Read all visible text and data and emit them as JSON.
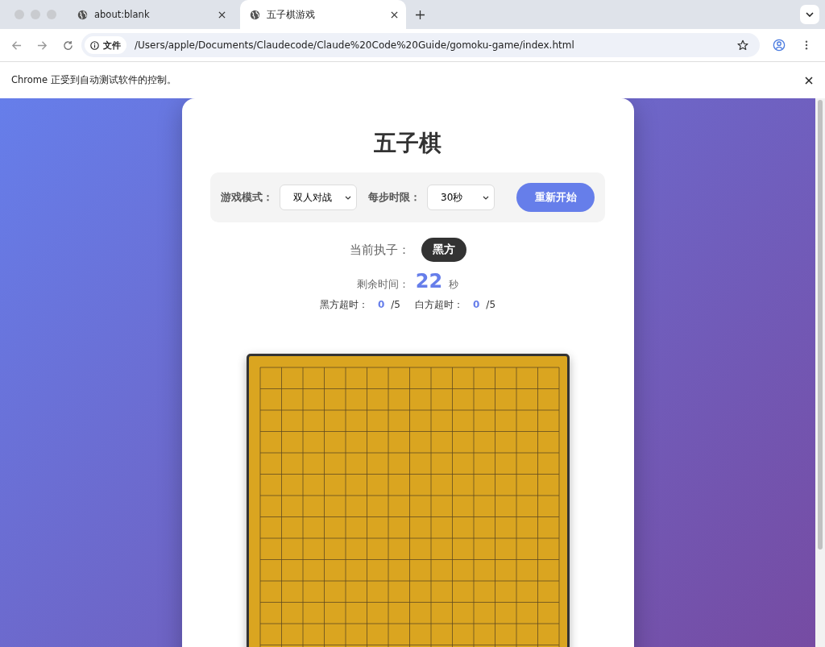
{
  "tabs": [
    {
      "title": "about:blank",
      "selected": false
    },
    {
      "title": "五子棋游戏",
      "selected": true
    }
  ],
  "address_bar": {
    "security_label": "文件",
    "url": "/Users/apple/Documents/Claudecode/Claude%20Code%20Guide/gomoku-game/index.html"
  },
  "infobar": {
    "message": "Chrome 正受到自动测试软件的控制。"
  },
  "game": {
    "title": "五子棋",
    "controls": [
      {
        "label": "游戏模式：",
        "value": "双人对战"
      },
      {
        "label": "每步时限：",
        "value": "30秒"
      }
    ],
    "restart_button": "重新开始",
    "current_player_label": "当前执子：",
    "current_player": "黑方",
    "time_label": "剩余时间：",
    "time_value": "22",
    "time_unit": "秒",
    "timeouts": [
      {
        "label": "黑方超时：",
        "count": "0",
        "limit": "/5"
      },
      {
        "label": "白方超时：",
        "count": "0",
        "limit": "/5"
      }
    ]
  }
}
